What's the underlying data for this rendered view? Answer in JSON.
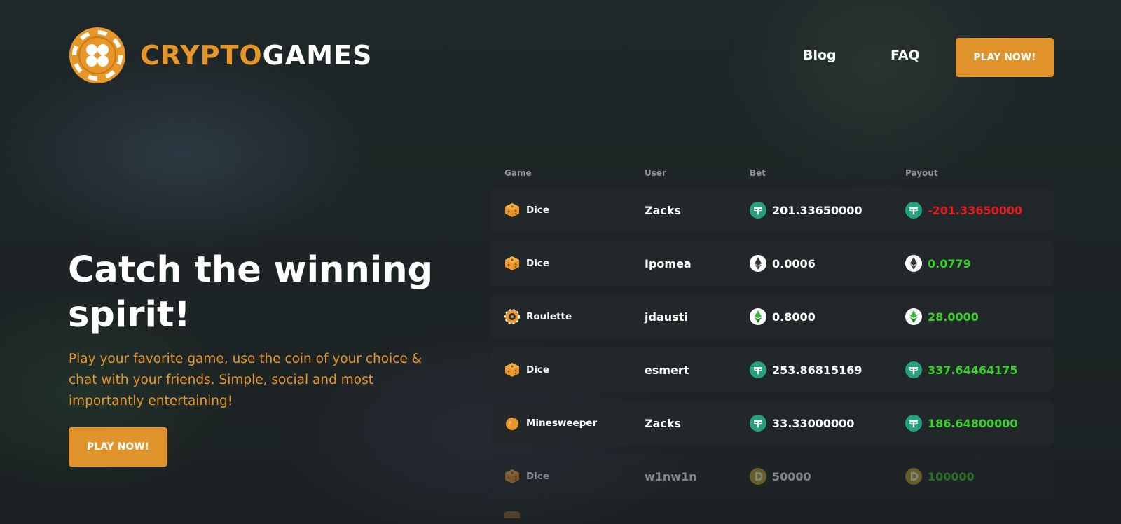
{
  "brand": {
    "part1": "CRYPTO",
    "part2": "GAMES",
    "accent": "#e7962a"
  },
  "nav": {
    "blog": "Blog",
    "faq": "FAQ",
    "cta": "PLAY NOW!"
  },
  "hero": {
    "title": "Catch the winning spirit!",
    "subtitle": "Play your favorite game, use the coin of your choice & chat with your friends. Simple, social and most importantly entertaining!",
    "cta": "PLAY NOW!"
  },
  "bets": {
    "headers": {
      "game": "Game",
      "user": "User",
      "bet": "Bet",
      "payout": "Payout"
    },
    "rows": [
      {
        "game": "Dice",
        "game_icon": "dice-icon",
        "user": "Zacks",
        "coin": "tether-icon",
        "bet": "201.33650000",
        "payout": "-201.33650000",
        "status": "loss"
      },
      {
        "game": "Dice",
        "game_icon": "dice-icon",
        "user": "Ipomea",
        "coin": "ethereum-icon",
        "bet": "0.0006",
        "payout": "0.0779",
        "status": "win"
      },
      {
        "game": "Roulette",
        "game_icon": "roulette-icon",
        "user": "jdausti",
        "coin": "ethereum-classic-icon",
        "bet": "0.8000",
        "payout": "28.0000",
        "status": "win"
      },
      {
        "game": "Dice",
        "game_icon": "dice-icon",
        "user": "esmert",
        "coin": "tether-icon",
        "bet": "253.86815169",
        "payout": "337.64464175",
        "status": "win"
      },
      {
        "game": "Minesweeper",
        "game_icon": "mine-icon",
        "user": "Zacks",
        "coin": "tether-icon",
        "bet": "33.33000000",
        "payout": "186.64800000",
        "status": "win"
      },
      {
        "game": "Dice",
        "game_icon": "dice-icon",
        "user": "w1nw1n",
        "coin": "dogecoin-icon",
        "bet": "50000",
        "payout": "100000",
        "status": "win"
      }
    ]
  },
  "colors": {
    "button": "#e0932a",
    "win": "#3bd12b",
    "loss": "#e71a1a",
    "tether": "#26a17b"
  }
}
